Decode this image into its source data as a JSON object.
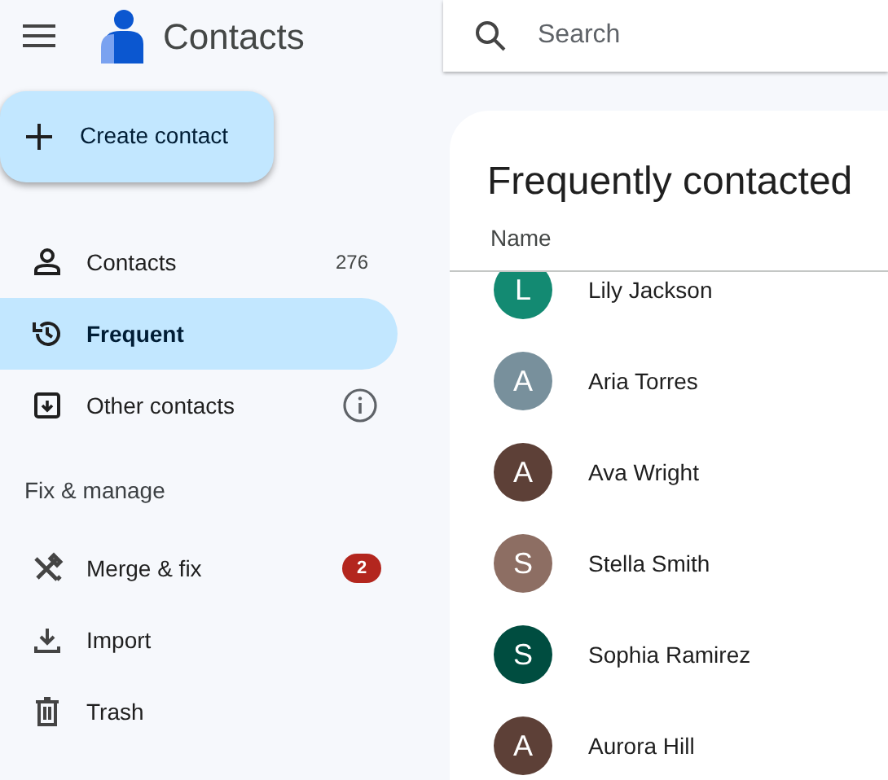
{
  "app": {
    "title": "Contacts"
  },
  "search": {
    "placeholder": "Search"
  },
  "create_button": {
    "label": "Create contact"
  },
  "nav": [
    {
      "label": "Contacts",
      "count": "276",
      "selected": false
    },
    {
      "label": "Frequent",
      "selected": true
    },
    {
      "label": "Other contacts",
      "selected": false
    }
  ],
  "section": {
    "heading": "Fix & manage",
    "items": [
      {
        "label": "Merge & fix",
        "badge": "2"
      },
      {
        "label": "Import"
      },
      {
        "label": "Trash"
      }
    ]
  },
  "main": {
    "title": "Frequently contacted",
    "column": "Name",
    "rows": [
      {
        "initial": "L",
        "name": "Lily Jackson",
        "color": "#138a72"
      },
      {
        "initial": "A",
        "name": "Aria Torres",
        "color": "#78909c"
      },
      {
        "initial": "A",
        "name": "Ava Wright",
        "color": "#5d4037"
      },
      {
        "initial": "S",
        "name": "Stella Smith",
        "color": "#8d6e63"
      },
      {
        "initial": "S",
        "name": "Sophia Ramirez",
        "color": "#004d40"
      },
      {
        "initial": "A",
        "name": "Aurora Hill",
        "color": "#5d4037"
      }
    ]
  }
}
